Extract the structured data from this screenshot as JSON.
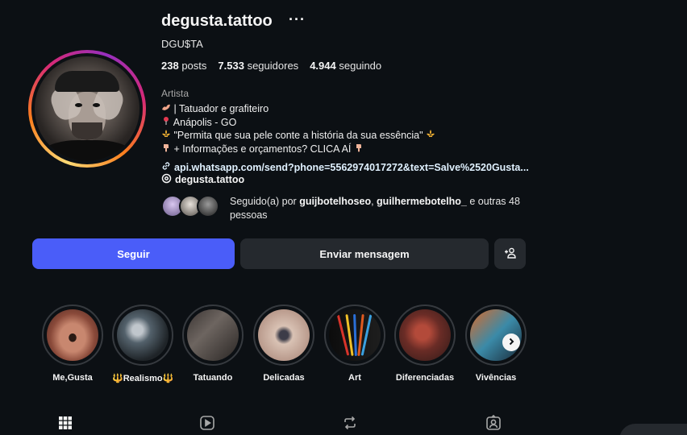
{
  "profile": {
    "username": "degusta.tattoo",
    "full_name": "DGU$TA",
    "stats": {
      "posts_count": "238",
      "posts_label": "posts",
      "followers_count": "7.533",
      "followers_label": "seguidores",
      "following_count": "4.944",
      "following_label": "seguindo"
    },
    "category": "Artista",
    "bio_lines": [
      "| Tatuador e grafiteiro",
      "Anápolis - GO",
      "\"Permita que sua pele conte a história da sua essência\"",
      "+ Informações e orçamentos? CLICA AÍ"
    ],
    "link": "api.whatsapp.com/send?phone=5562974017272&text=Salve%2520Gusta...",
    "threads_handle": "degusta.tattoo",
    "followed_by": {
      "prefix": "Seguido(a) por",
      "user1": "guijbotelhoseo",
      "sep": ",",
      "user2": "guilhermebotelho_",
      "suffix": "e outras 48 pessoas"
    }
  },
  "actions": {
    "follow_label": "Seguir",
    "message_label": "Enviar mensagem"
  },
  "highlights": [
    {
      "label": "Me,Gusta"
    },
    {
      "label": "🔱Realismo🔱"
    },
    {
      "label": "Tatuando"
    },
    {
      "label": "Delicadas"
    },
    {
      "label": "Art"
    },
    {
      "label": "Diferenciadas"
    },
    {
      "label": "Vivências"
    }
  ],
  "tabs": [
    {
      "icon": "grid-icon"
    },
    {
      "icon": "reels-icon"
    },
    {
      "icon": "repost-icon"
    },
    {
      "icon": "tagged-icon"
    }
  ],
  "colors": {
    "background": "#0c1014",
    "follow_button": "#4a5df9",
    "secondary_button": "#25292e",
    "link": "#e0f1ff"
  }
}
